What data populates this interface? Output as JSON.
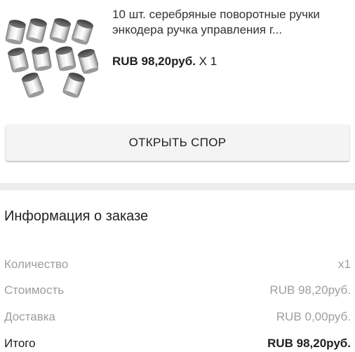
{
  "product": {
    "image_icon": "silver-knobs-product-image",
    "title": "10 шт. серебряные поворотные ручки энкодера ручка управления г...",
    "price": "RUB 98,20руб.",
    "quantity": "X 1"
  },
  "actions": {
    "open_dispute_label": "ОТКРЫТЬ СПОР"
  },
  "order_info": {
    "title": "Информация о заказе",
    "rows": [
      {
        "label": "Количество",
        "value": "x1"
      },
      {
        "label": "Стоимость",
        "value": "RUB 98,20руб."
      },
      {
        "label": "Доставка",
        "value": "RUB 0,00руб."
      },
      {
        "label": "Итого",
        "value": "RUB 98,20руб."
      }
    ]
  },
  "colors": {
    "background": "#ffffff",
    "button_background": "#f4f4f4",
    "divider_band": "#eeeeee",
    "muted_text": "#9e9e9e",
    "primary_text": "#212121"
  }
}
